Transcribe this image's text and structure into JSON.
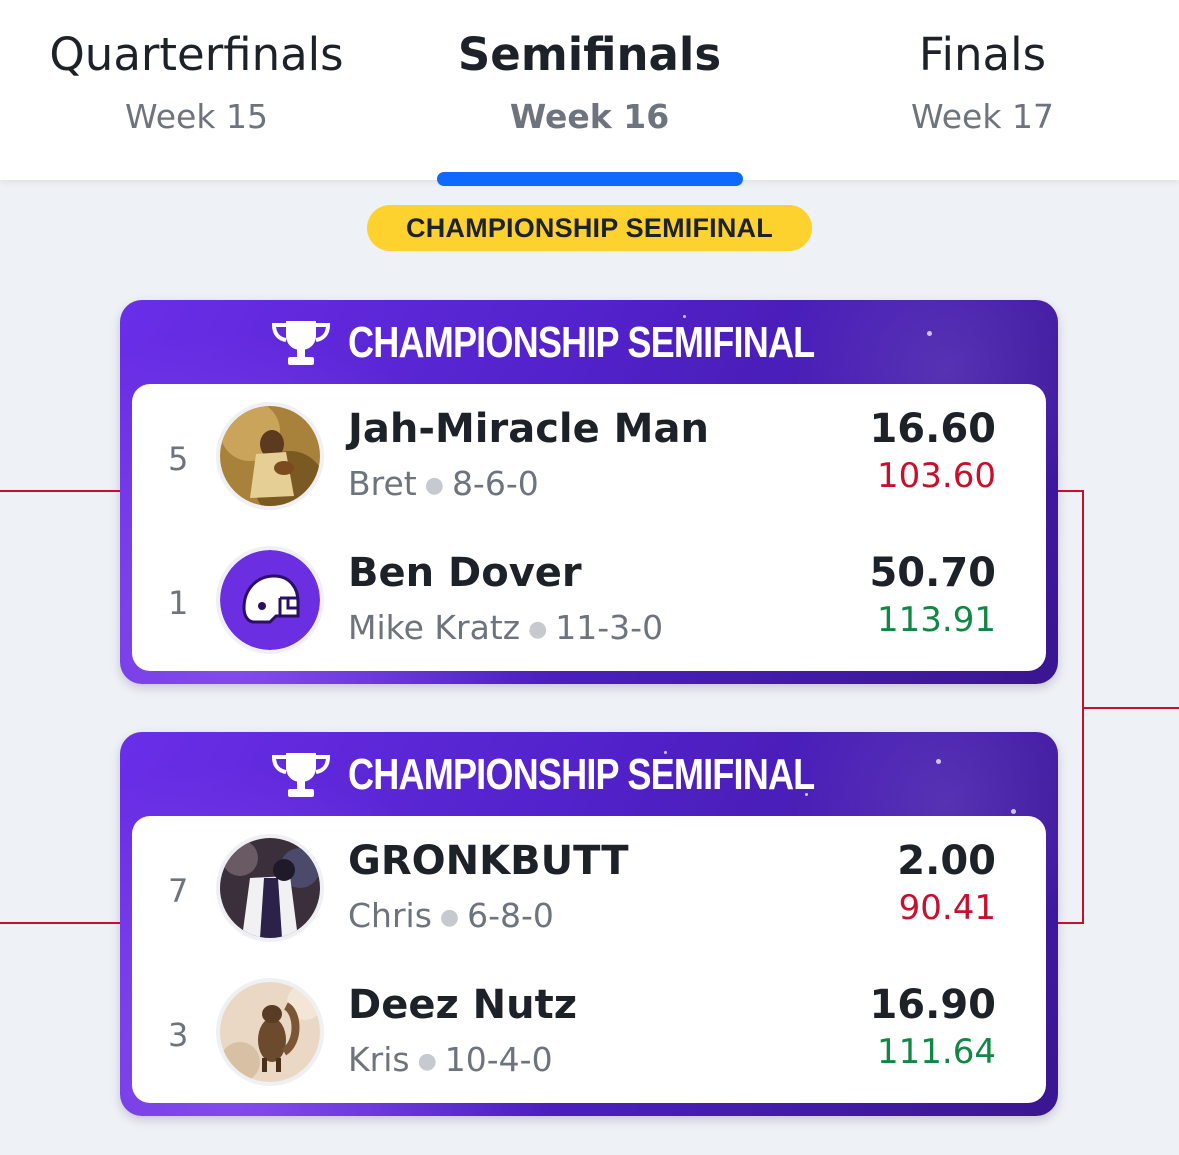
{
  "tabs": [
    {
      "title": "Quarterfinals",
      "week": "Week 15"
    },
    {
      "title": "Semifinals",
      "week": "Week 16"
    },
    {
      "title": "Finals",
      "week": "Week 17"
    }
  ],
  "active_tab": "Semifinals",
  "round_pill": "CHAMPIONSHIP SEMIFINAL",
  "colors": {
    "accent": "#0f69ff",
    "pill": "#fdd12e",
    "card_purple": "#5021c8",
    "bracket_line": "#c8102e",
    "loser_projection": "#c8102e",
    "winner_projection": "#118744"
  },
  "matchups": [
    {
      "title": "CHAMPIONSHIP SEMIFINAL",
      "icon": "trophy-icon",
      "teams": [
        {
          "seed": "5",
          "name": "Jah-Miracle Man",
          "manager": "Bret",
          "record": "8-6-0",
          "score": "16.60",
          "projected": "103.60",
          "avatar": "painting-avatar"
        },
        {
          "seed": "1",
          "name": "Ben Dover",
          "manager": "Mike Kratz",
          "record": "11-3-0",
          "score": "50.70",
          "projected": "113.91",
          "avatar": "helmet-icon"
        }
      ]
    },
    {
      "title": "CHAMPIONSHIP SEMIFINAL",
      "icon": "trophy-icon",
      "teams": [
        {
          "seed": "7",
          "name": "GRONKBUTT",
          "manager": "Chris",
          "record": "6-8-0",
          "score": "2.00",
          "projected": "90.41",
          "avatar": "football-photo-avatar"
        },
        {
          "seed": "3",
          "name": "Deez Nutz",
          "manager": "Kris",
          "record": "10-4-0",
          "score": "16.90",
          "projected": "111.64",
          "avatar": "squirrel-avatar"
        }
      ]
    }
  ]
}
